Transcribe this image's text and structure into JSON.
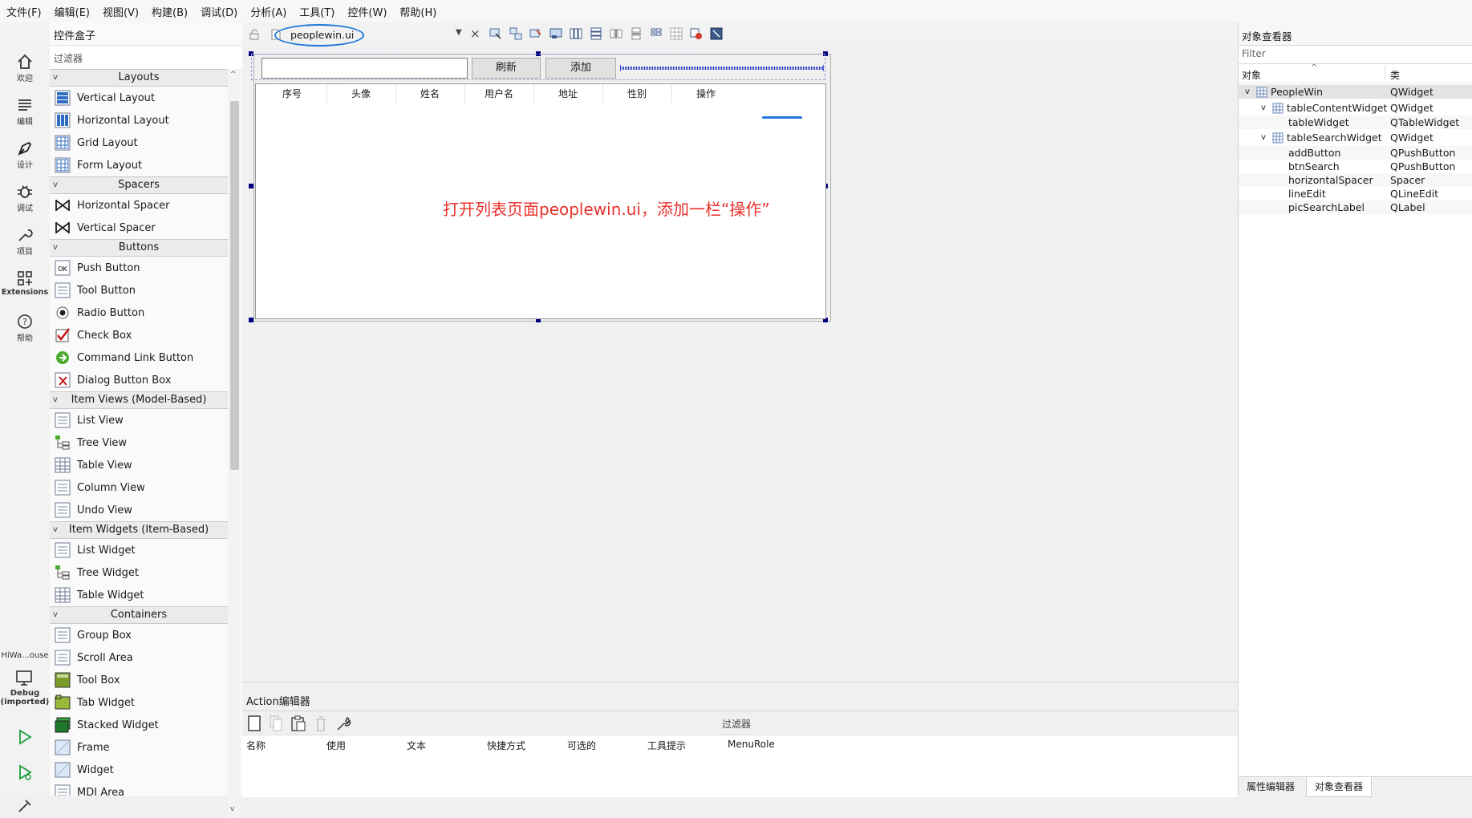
{
  "menubar": [
    "文件(F)",
    "编辑(E)",
    "视图(V)",
    "构建(B)",
    "调试(D)",
    "分析(A)",
    "工具(T)",
    "控件(W)",
    "帮助(H)"
  ],
  "modebar": {
    "modes": [
      "欢迎",
      "编辑",
      "设计",
      "调试",
      "项目",
      "Extensions",
      "帮助"
    ],
    "kit_name": "HiWa...ouse",
    "debug_label": "Debug",
    "debug_sub": "(imported)"
  },
  "widgetbox": {
    "title": "控件盒子",
    "filter_placeholder": "过滤器",
    "categories": [
      {
        "name": "Layouts",
        "items": [
          "Vertical Layout",
          "Horizontal Layout",
          "Grid Layout",
          "Form Layout"
        ]
      },
      {
        "name": "Spacers",
        "items": [
          "Horizontal Spacer",
          "Vertical Spacer"
        ]
      },
      {
        "name": "Buttons",
        "items": [
          "Push Button",
          "Tool Button",
          "Radio Button",
          "Check Box",
          "Command Link Button",
          "Dialog Button Box"
        ]
      },
      {
        "name": "Item Views (Model-Based)",
        "items": [
          "List View",
          "Tree View",
          "Table View",
          "Column View",
          "Undo View"
        ]
      },
      {
        "name": "Item Widgets (Item-Based)",
        "items": [
          "List Widget",
          "Tree Widget",
          "Table Widget"
        ]
      },
      {
        "name": "Containers",
        "items": [
          "Group Box",
          "Scroll Area",
          "Tool Box",
          "Tab Widget",
          "Stacked Widget",
          "Frame",
          "Widget",
          "MDI Area"
        ]
      }
    ]
  },
  "designbar": {
    "file_name": "peoplewin.ui"
  },
  "form": {
    "refresh_button": "刷新",
    "add_button": "添加",
    "table_headers": [
      "序号",
      "头像",
      "姓名",
      "用户名",
      "地址",
      "性别",
      "操作"
    ],
    "annotation": "打开列表页面peoplewin.ui，添加一栏“操作”"
  },
  "action_editor": {
    "title": "Action编辑器",
    "filter_label": "过滤器",
    "columns": [
      "名称",
      "使用",
      "文本",
      "快捷方式",
      "可选的",
      "工具提示",
      "MenuRole"
    ]
  },
  "object_inspector": {
    "title": "对象查看器",
    "filter_placeholder": "Filter",
    "col_object": "对象",
    "col_class": "类",
    "rows": [
      {
        "name": "PeopleWin",
        "cls": "QWidget"
      },
      {
        "name": "tableContentWidget",
        "cls": "QWidget"
      },
      {
        "name": "tableWidget",
        "cls": "QTableWidget"
      },
      {
        "name": "tableSearchWidget",
        "cls": "QWidget"
      },
      {
        "name": "addButton",
        "cls": "QPushButton"
      },
      {
        "name": "btnSearch",
        "cls": "QPushButton"
      },
      {
        "name": "horizontalSpacer",
        "cls": "Spacer"
      },
      {
        "name": "lineEdit",
        "cls": "QLineEdit"
      },
      {
        "name": "picSearchLabel",
        "cls": "QLabel"
      }
    ],
    "tabs": [
      "属性编辑器",
      "对象查看器"
    ]
  },
  "colors": {
    "annotation_red": "#e8322c",
    "highlight_blue": "#1e78dc",
    "handle_navy": "#000080"
  }
}
